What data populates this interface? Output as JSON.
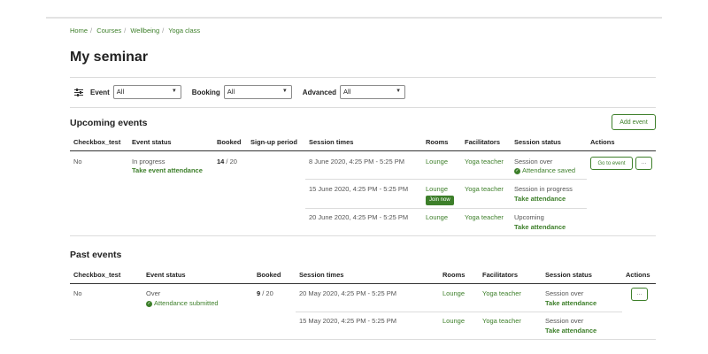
{
  "breadcrumb": [
    "Home",
    "Courses",
    "Wellbeing",
    "Yoga class"
  ],
  "page_title": "My seminar",
  "filters": {
    "icon": "sliders-icon",
    "event_label": "Event",
    "event_value": "All",
    "booking_label": "Booking",
    "booking_value": "All",
    "advanced_label": "Advanced",
    "advanced_value": "All"
  },
  "upcoming": {
    "title": "Upcoming events",
    "add_button": "Add event",
    "headers": [
      "Checkbox_test",
      "Event status",
      "Booked",
      "Sign-up period",
      "Session times",
      "Rooms",
      "Facilitators",
      "Session status",
      "Actions"
    ],
    "row": {
      "checkbox": "No",
      "status": "In progress",
      "status_link": "Take event attendance",
      "booked": "14",
      "capacity": " / 20",
      "goto_button": "Go to event",
      "more_button": "···",
      "sessions": [
        {
          "time": "8 June 2020, 4:25 PM - 5:25 PM",
          "room": "Lounge",
          "facilitator": "Yoga teacher",
          "status": "Session over",
          "status_detail": "Attendance saved"
        },
        {
          "time": "15 June 2020, 4:25 PM - 5:25 PM",
          "room": "Lounge",
          "room_badge": "Join now",
          "facilitator": "Yoga teacher",
          "status": "Session in progress",
          "status_link": "Take attendance"
        },
        {
          "time": "20 June 2020, 4:25 PM - 5:25 PM",
          "room": "Lounge",
          "facilitator": "Yoga teacher",
          "status": "Upcoming",
          "status_link": "Take attendance"
        }
      ]
    }
  },
  "past": {
    "title": "Past events",
    "headers": [
      "Checkbox_test",
      "Event status",
      "Booked",
      "Session times",
      "Rooms",
      "Facilitators",
      "Session status",
      "Actions"
    ],
    "row": {
      "checkbox": "No",
      "status": "Over",
      "status_detail": "Attendance submitted",
      "booked": "9",
      "capacity": " / 20",
      "more_button": "···",
      "sessions": [
        {
          "time": "20 May 2020, 4:25 PM - 5:25 PM",
          "room": "Lounge",
          "facilitator": "Yoga teacher",
          "status": "Session over",
          "status_link": "Take attendance"
        },
        {
          "time": "15 May 2020, 4:25 PM - 5:25 PM",
          "room": "Lounge",
          "facilitator": "Yoga teacher",
          "status": "Session over",
          "status_link": "Take attendance"
        }
      ]
    }
  },
  "colors": {
    "accent": "#3d7f2a",
    "rule": "#dcdcdc"
  }
}
